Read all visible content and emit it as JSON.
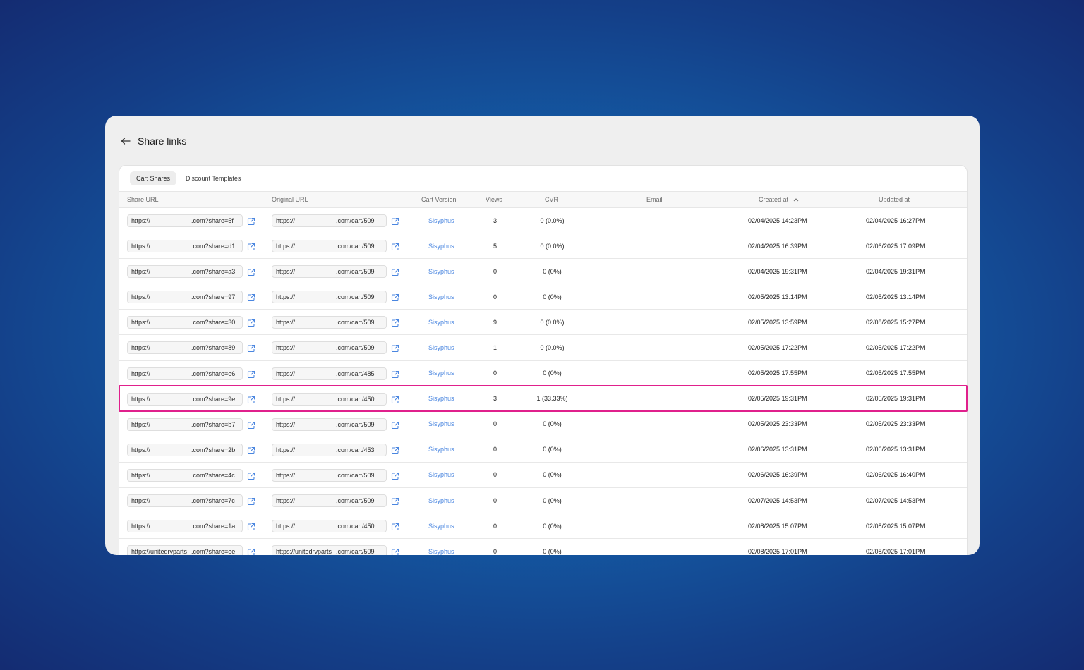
{
  "page": {
    "title": "Share links"
  },
  "tabs": [
    "Cart Shares",
    "Discount Templates"
  ],
  "columns": {
    "share_url": "Share URL",
    "original_url": "Original URL",
    "cart_version": "Cart Version",
    "views": "Views",
    "cvr": "CVR",
    "email": "Email",
    "created_at": "Created at",
    "updated_at": "Updated at"
  },
  "sort": {
    "column": "Created at",
    "direction": "ascending"
  },
  "colors": {
    "link": "#4a86e0",
    "highlight": "#e0208c",
    "background": "#135ea8"
  },
  "rows": [
    {
      "share_pre": "https://",
      "share_suf": ".com?share=5f",
      "orig_pre": "https://",
      "orig_suf": ".com/cart/509",
      "version": "Sisyphus",
      "views": "3",
      "cvr": "0 (0.0%)",
      "email": "",
      "created": "02/04/2025 14:23PM",
      "updated": "02/04/2025 16:27PM"
    },
    {
      "share_pre": "https://",
      "share_suf": ".com?share=d1",
      "orig_pre": "https://",
      "orig_suf": ".com/cart/509",
      "version": "Sisyphus",
      "views": "5",
      "cvr": "0 (0.0%)",
      "email": "",
      "created": "02/04/2025 16:39PM",
      "updated": "02/06/2025 17:09PM"
    },
    {
      "share_pre": "https://",
      "share_suf": ".com?share=a3",
      "orig_pre": "https://",
      "orig_suf": ".com/cart/509",
      "version": "Sisyphus",
      "views": "0",
      "cvr": "0 (0%)",
      "email": "",
      "created": "02/04/2025 19:31PM",
      "updated": "02/04/2025 19:31PM"
    },
    {
      "share_pre": "https://",
      "share_suf": ".com?share=97",
      "orig_pre": "https://",
      "orig_suf": ".com/cart/509",
      "version": "Sisyphus",
      "views": "0",
      "cvr": "0 (0%)",
      "email": "",
      "created": "02/05/2025 13:14PM",
      "updated": "02/05/2025 13:14PM"
    },
    {
      "share_pre": "https://",
      "share_suf": ".com?share=30",
      "orig_pre": "https://",
      "orig_suf": ".com/cart/509",
      "version": "Sisyphus",
      "views": "9",
      "cvr": "0 (0.0%)",
      "email": "",
      "created": "02/05/2025 13:59PM",
      "updated": "02/08/2025 15:27PM"
    },
    {
      "share_pre": "https://",
      "share_suf": ".com?share=89",
      "orig_pre": "https://",
      "orig_suf": ".com/cart/509",
      "version": "Sisyphus",
      "views": "1",
      "cvr": "0 (0.0%)",
      "email": "",
      "created": "02/05/2025 17:22PM",
      "updated": "02/05/2025 17:22PM"
    },
    {
      "share_pre": "https://",
      "share_suf": ".com?share=e6",
      "orig_pre": "https://",
      "orig_suf": ".com/cart/485",
      "version": "Sisyphus",
      "views": "0",
      "cvr": "0 (0%)",
      "email": "",
      "created": "02/05/2025 17:55PM",
      "updated": "02/05/2025 17:55PM"
    },
    {
      "share_pre": "https://",
      "share_suf": ".com?share=9e",
      "orig_pre": "https://",
      "orig_suf": ".com/cart/450",
      "version": "Sisyphus",
      "views": "3",
      "cvr": "1 (33.33%)",
      "email": "",
      "created": "02/05/2025 19:31PM",
      "updated": "02/05/2025 19:31PM",
      "highlighted": true
    },
    {
      "share_pre": "https://",
      "share_suf": ".com?share=b7",
      "orig_pre": "https://",
      "orig_suf": ".com/cart/509",
      "version": "Sisyphus",
      "views": "0",
      "cvr": "0 (0%)",
      "email": "",
      "created": "02/05/2025 23:33PM",
      "updated": "02/05/2025 23:33PM"
    },
    {
      "share_pre": "https://",
      "share_suf": ".com?share=2b",
      "orig_pre": "https://",
      "orig_suf": ".com/cart/453",
      "version": "Sisyphus",
      "views": "0",
      "cvr": "0 (0%)",
      "email": "",
      "created": "02/06/2025 13:31PM",
      "updated": "02/06/2025 13:31PM"
    },
    {
      "share_pre": "https://",
      "share_suf": ".com?share=4c",
      "orig_pre": "https://",
      "orig_suf": ".com/cart/509",
      "version": "Sisyphus",
      "views": "0",
      "cvr": "0 (0%)",
      "email": "",
      "created": "02/06/2025 16:39PM",
      "updated": "02/06/2025 16:40PM"
    },
    {
      "share_pre": "https://",
      "share_suf": ".com?share=7c",
      "orig_pre": "https://",
      "orig_suf": ".com/cart/509",
      "version": "Sisyphus",
      "views": "0",
      "cvr": "0 (0%)",
      "email": "",
      "created": "02/07/2025 14:53PM",
      "updated": "02/07/2025 14:53PM"
    },
    {
      "share_pre": "https://",
      "share_suf": ".com?share=1a",
      "orig_pre": "https://",
      "orig_suf": ".com/cart/450",
      "version": "Sisyphus",
      "views": "0",
      "cvr": "0 (0%)",
      "email": "",
      "created": "02/08/2025 15:07PM",
      "updated": "02/08/2025 15:07PM"
    },
    {
      "share_pre": "https://unitedrvparts",
      "share_suf": ".com?share=ee",
      "orig_pre": "https://unitedrvparts",
      "orig_suf": ".com/cart/509",
      "version": "Sisyphus",
      "views": "0",
      "cvr": "0 (0%)",
      "email": "",
      "created": "02/08/2025 17:01PM",
      "updated": "02/08/2025 17:01PM"
    }
  ]
}
